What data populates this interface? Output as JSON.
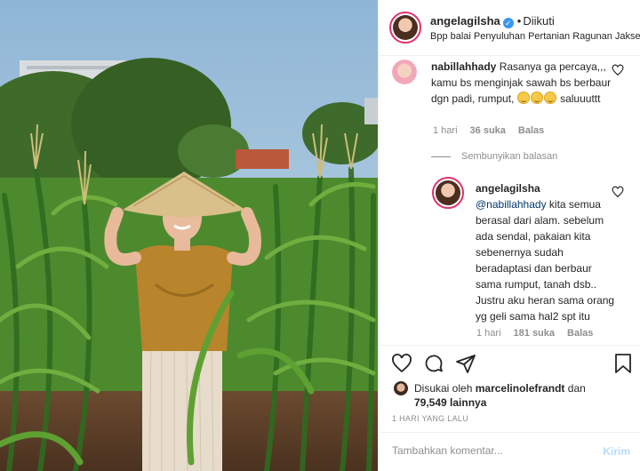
{
  "post": {
    "username": "angelagilsha",
    "verified": true,
    "follow_status": "Diikuti",
    "location": "Bpp balai Penyuluhan Pertanian Ragunan Jaksel"
  },
  "comments": [
    {
      "username": "nabillahhady",
      "text": "Rasanya ga percaya,,, kamu bs menginjak sawah bs berbaur dgn padi, rumput,",
      "emoji_count": 3,
      "text_after_emoji": "saluuuttt",
      "time": "1 hari",
      "likes": "36 suka",
      "reply_label": "Balas",
      "hide_replies_label": "Sembunyikan balasan",
      "replies": [
        {
          "username": "angelagilsha",
          "mention": "@nabillahhady",
          "text": "kita semua berasal dari alam. sebelum ada sendal, pakaian kita sebenernya sudah beradaptasi dan berbaur sama rumput, tanah dsb.. Justru aku heran sama orang yg geli sama hal2 spt itu",
          "time": "1 hari",
          "likes": "181 suka",
          "reply_label": "Balas"
        }
      ]
    }
  ],
  "actions": {
    "icons": [
      "heart-icon",
      "comment-icon",
      "share-icon",
      "bookmark-icon"
    ]
  },
  "likes": {
    "prefix": "Disukai oleh",
    "user": "marcelinolefrandt",
    "connector": "dan",
    "others": "79,549 lainnya"
  },
  "post_date": "1 HARI YANG LALU",
  "comment_box": {
    "placeholder": "Tambahkan komentar...",
    "post_label": "Kirim"
  },
  "colors": {
    "accent": "#3897f0",
    "post_button_disabled": "#b3dbff",
    "secondary_text": "#8e8e8e",
    "story_ring": "#e1306c"
  }
}
